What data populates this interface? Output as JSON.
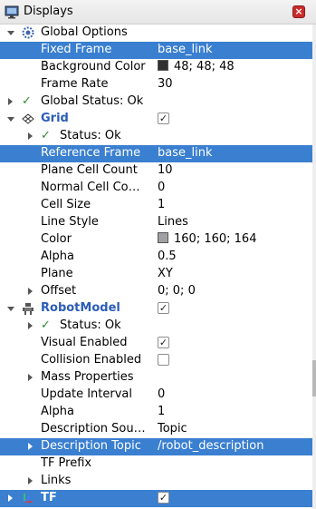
{
  "panel": {
    "title": "Displays",
    "close_symbol": "×"
  },
  "global_options": {
    "label": "Global Options",
    "fixed_frame": {
      "label": "Fixed Frame",
      "value": "base_link"
    },
    "background_color": {
      "label": "Background Color",
      "value": "48; 48; 48",
      "color": "#303030"
    },
    "frame_rate": {
      "label": "Frame Rate",
      "value": "30"
    }
  },
  "global_status": {
    "label": "Global Status: Ok"
  },
  "grid": {
    "label": "Grid",
    "enabled": true,
    "status": "Status: Ok",
    "reference_frame": {
      "label": "Reference Frame",
      "value": "base_link"
    },
    "plane_cell_count": {
      "label": "Plane Cell Count",
      "value": "10"
    },
    "normal_cell_count": {
      "label": "Normal Cell Co…",
      "value": "0"
    },
    "cell_size": {
      "label": "Cell Size",
      "value": "1"
    },
    "line_style": {
      "label": "Line Style",
      "value": "Lines"
    },
    "color": {
      "label": "Color",
      "value": "160; 160; 164",
      "color": "#a0a0a4"
    },
    "alpha": {
      "label": "Alpha",
      "value": "0.5"
    },
    "plane": {
      "label": "Plane",
      "value": "XY"
    },
    "offset": {
      "label": "Offset",
      "value": "0; 0; 0"
    }
  },
  "robot_model": {
    "label": "RobotModel",
    "enabled": true,
    "status": "Status: Ok",
    "visual_enabled": {
      "label": "Visual Enabled",
      "value": true
    },
    "collision_enabled": {
      "label": "Collision Enabled",
      "value": false
    },
    "mass_properties": {
      "label": "Mass Properties"
    },
    "update_interval": {
      "label": "Update Interval",
      "value": "0"
    },
    "alpha": {
      "label": "Alpha",
      "value": "1"
    },
    "description_source": {
      "label": "Description Sou…",
      "value": "Topic"
    },
    "description_topic": {
      "label": "Description Topic",
      "value": "/robot_description"
    },
    "tf_prefix": {
      "label": "TF Prefix"
    },
    "links": {
      "label": "Links"
    }
  },
  "tf": {
    "label": "TF",
    "enabled": true
  },
  "colors": {
    "selection": "#3a7fd0",
    "display_name": "#2b5cb8",
    "status_ok": "#2e8b2e"
  }
}
